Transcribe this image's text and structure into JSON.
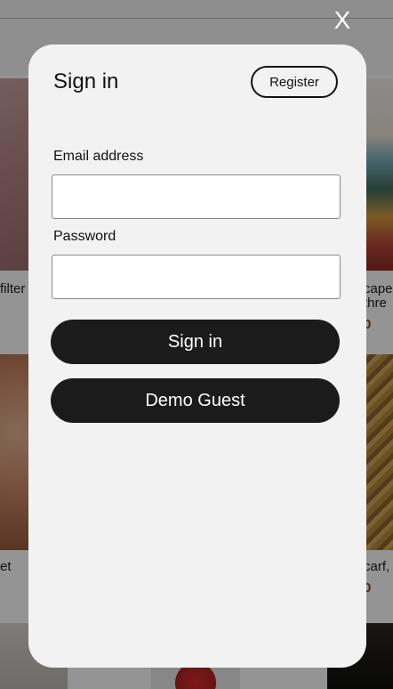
{
  "background": {
    "tile_texts": {
      "left_1": "filter",
      "right_1_line1": "cape",
      "right_1_line2": "thre",
      "right_1_price": "0",
      "left_2": "et",
      "right_2": "carf,",
      "right_2_price": "0"
    }
  },
  "close_label": "X",
  "modal": {
    "title": "Sign in",
    "register_label": "Register",
    "email_label": "Email address",
    "email_value": "",
    "password_label": "Password",
    "password_value": "",
    "signin_label": "Sign in",
    "guest_label": "Demo Guest"
  },
  "colors": {
    "button_dark": "#1b1b1b",
    "modal_bg": "#f2f2f2",
    "price": "#7a4a12"
  }
}
